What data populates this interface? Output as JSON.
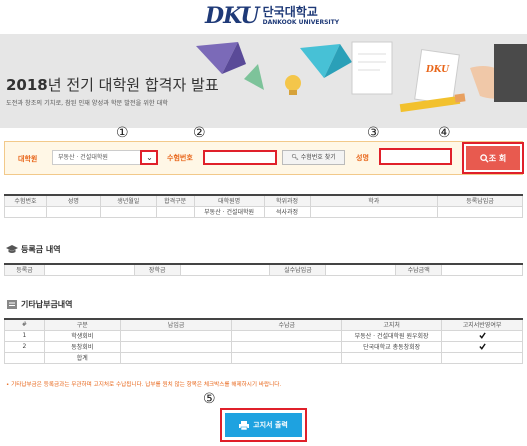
{
  "logo": {
    "mark": "DKU",
    "name_kr": "단국대학교",
    "name_en": "DANKOOK UNIVERSITY"
  },
  "banner": {
    "title_year": "2018",
    "title_rest": "년 전기 대학원 합격자 발표",
    "subtitle": "도전과 창조의 기치로, 참된 인재 양성과 학문 발전을 위한 대학",
    "illustration_mark": "DKU"
  },
  "search": {
    "univ_label": "대학원",
    "univ_value": "부동산 · 건설대학원",
    "exam_label": "수험번호",
    "exam_value": "",
    "find_label": "수험번호 찾기",
    "name_label": "성명",
    "name_value": "",
    "query_label": "조 회"
  },
  "markers": {
    "m1": "①",
    "m2": "②",
    "m3": "③",
    "m4": "④",
    "m5": "⑤"
  },
  "applicant_table": {
    "headers": [
      "수험번호",
      "성명",
      "생년월일",
      "합격구분",
      "대학원명",
      "학위과정",
      "학과",
      "등록납입금"
    ],
    "row": [
      "",
      "",
      "",
      "",
      "부동산 · 건설대학원",
      "석사과정",
      "",
      ""
    ]
  },
  "tuition": {
    "title": "등록금 내역",
    "labels": [
      "등록금",
      "장학금",
      "실수납입금",
      "수납금액"
    ],
    "values": [
      "",
      "",
      "",
      ""
    ]
  },
  "other_fees": {
    "title": "기타납부금내역",
    "headers": [
      "#",
      "구분",
      "납입금",
      "수납금",
      "고지처",
      "고지서반영여부"
    ],
    "rows": [
      {
        "no": "1",
        "type": "학생회비",
        "paid": "",
        "received": "",
        "issuer": "부동산 · 건설대학원 원우회장",
        "checked": true
      },
      {
        "no": "2",
        "type": "동창회비",
        "paid": "",
        "received": "",
        "issuer": "단국대학교 총동창회장",
        "checked": true
      },
      {
        "no": "",
        "type": "합계",
        "paid": "",
        "received": "",
        "issuer": "",
        "checked": false
      }
    ]
  },
  "notice": "• 기타납부금은 등록금과는 무관하며 고지처로 수납됩니다. 납부를 원치 않는 항목은 체크박스를 해제하시기 바랍니다.",
  "print_button": {
    "label": "고지서 출력"
  },
  "colors": {
    "accent_orange": "#e8661a",
    "highlight_red": "#e0202a",
    "query_red": "#e85a4f",
    "print_blue": "#1ea2e0",
    "logo_navy": "#1f3a78"
  }
}
